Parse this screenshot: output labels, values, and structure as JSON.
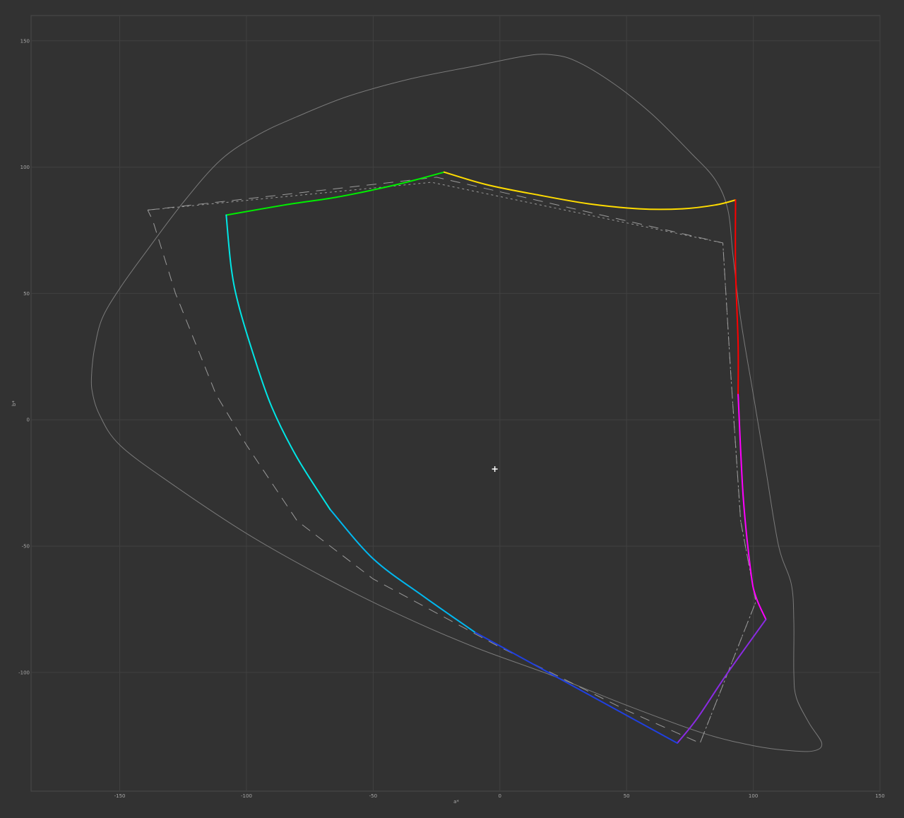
{
  "chart_data": {
    "type": "line",
    "xlabel": "a*",
    "ylabel": "b*",
    "xlim": [
      -185,
      150
    ],
    "ylim": [
      -147,
      160
    ],
    "xticks": [
      -150,
      -100,
      -50,
      0,
      50,
      100,
      150
    ],
    "yticks": [
      150,
      100,
      50,
      0,
      -50,
      -100
    ],
    "xtick_labels": [
      "-150",
      "-100",
      "-50",
      "0",
      "50",
      "100",
      "150"
    ],
    "ytick_labels": [
      "150",
      "100",
      "50",
      "0",
      "-50",
      "-100"
    ],
    "grid": true,
    "white_point": {
      "x": -2,
      "y": -19.5
    },
    "colors": {
      "background": "#323232",
      "grid": "#414141",
      "frame": "#4a4a4a",
      "outline": "#7a7a7a",
      "reference": "#9a9a9a",
      "white_point": "#ffffff"
    },
    "series": [
      {
        "style": "solid-thin",
        "points": [
          [
            -161,
            20
          ],
          [
            -160,
            28
          ],
          [
            -157,
            40
          ],
          [
            -150,
            52
          ],
          [
            -140,
            66
          ],
          [
            -125,
            86
          ],
          [
            -110,
            103
          ],
          [
            -95,
            113
          ],
          [
            -80,
            120
          ],
          [
            -60,
            128
          ],
          [
            -35,
            135
          ],
          [
            -10,
            140
          ],
          [
            10,
            144
          ],
          [
            20,
            144.5
          ],
          [
            30,
            142
          ],
          [
            45,
            133
          ],
          [
            60,
            121
          ],
          [
            75,
            106
          ],
          [
            85,
            95
          ],
          [
            90,
            83
          ],
          [
            92,
            65
          ],
          [
            95,
            40
          ],
          [
            100,
            10
          ],
          [
            105,
            -20
          ],
          [
            110,
            -50
          ],
          [
            115,
            -65
          ],
          [
            116,
            -80
          ],
          [
            116,
            -100
          ],
          [
            117,
            -110
          ],
          [
            122,
            -120
          ],
          [
            127,
            -128
          ],
          [
            124,
            -131
          ],
          [
            115,
            -131
          ],
          [
            100,
            -129
          ],
          [
            80,
            -124
          ],
          [
            50,
            -113
          ],
          [
            20,
            -101
          ],
          [
            -10,
            -90
          ],
          [
            -40,
            -77
          ],
          [
            -70,
            -62
          ],
          [
            -100,
            -45
          ],
          [
            -130,
            -25
          ],
          [
            -150,
            -10
          ],
          [
            -158,
            2
          ],
          [
            -161,
            12
          ],
          [
            -161,
            20
          ]
        ]
      },
      {
        "style": "dashed-long",
        "points": [
          [
            -139,
            83
          ],
          [
            -25,
            96
          ],
          [
            88,
            70
          ],
          [
            91,
            20
          ],
          [
            95,
            -40
          ],
          [
            101,
            -72
          ],
          [
            79,
            -128
          ],
          [
            70,
            -124
          ],
          [
            50,
            -115
          ],
          [
            0,
            -90
          ],
          [
            -50,
            -63
          ],
          [
            -80,
            -40
          ],
          [
            -100,
            -10
          ],
          [
            -112,
            10
          ],
          [
            -128,
            50
          ],
          [
            -137,
            79
          ],
          [
            -139,
            83
          ]
        ]
      },
      {
        "style": "dashed-short",
        "points": [
          [
            -139,
            83
          ],
          [
            -27,
            94
          ],
          [
            88,
            70
          ],
          [
            91,
            20
          ],
          [
            95,
            -40
          ],
          [
            101,
            -72
          ],
          [
            79,
            -128
          ]
        ]
      },
      {
        "style": "solid-color",
        "segments": [
          {
            "color": "#00ee00",
            "points": [
              [
                -108,
                81
              ],
              [
                -85,
                85
              ],
              [
                -65,
                88
              ],
              [
                -50,
                91
              ],
              [
                -37,
                94
              ],
              [
                -22,
                98
              ]
            ]
          },
          {
            "color": "#ffdc00",
            "points": [
              [
                -22,
                98
              ],
              [
                -5,
                93
              ],
              [
                15,
                89
              ],
              [
                35,
                85.5
              ],
              [
                55,
                83.5
              ],
              [
                72,
                83.5
              ],
              [
                85,
                85
              ],
              [
                93,
                87
              ]
            ]
          },
          {
            "color": "#ff0000",
            "points": [
              [
                93,
                87
              ],
              [
                93,
                60
              ],
              [
                94,
                30
              ],
              [
                94,
                10
              ]
            ]
          },
          {
            "color": "#ff00ff",
            "points": [
              [
                94,
                10
              ],
              [
                96,
                -30
              ],
              [
                99,
                -60
              ],
              [
                101,
                -70
              ],
              [
                105,
                -79
              ]
            ]
          },
          {
            "color": "#8a2be2",
            "points": [
              [
                105,
                -79
              ],
              [
                90,
                -100
              ],
              [
                78,
                -118
              ],
              [
                70,
                -128
              ]
            ]
          },
          {
            "color": "#2040e0",
            "points": [
              [
                70,
                -128
              ],
              [
                50,
                -117
              ],
              [
                30,
                -106
              ],
              [
                10,
                -95
              ],
              [
                -10,
                -84
              ]
            ]
          },
          {
            "color": "#00b8f0",
            "points": [
              [
                -10,
                -84
              ],
              [
                -30,
                -70
              ],
              [
                -50,
                -55
              ],
              [
                -67,
                -35.5
              ]
            ]
          },
          {
            "color": "#00e6e6",
            "points": [
              [
                -67,
                -35.5
              ],
              [
                -80,
                -15
              ],
              [
                -90,
                5
              ],
              [
                -97,
                25
              ],
              [
                -103,
                45
              ],
              [
                -106,
                60
              ],
              [
                -108,
                81
              ]
            ]
          }
        ]
      }
    ]
  }
}
